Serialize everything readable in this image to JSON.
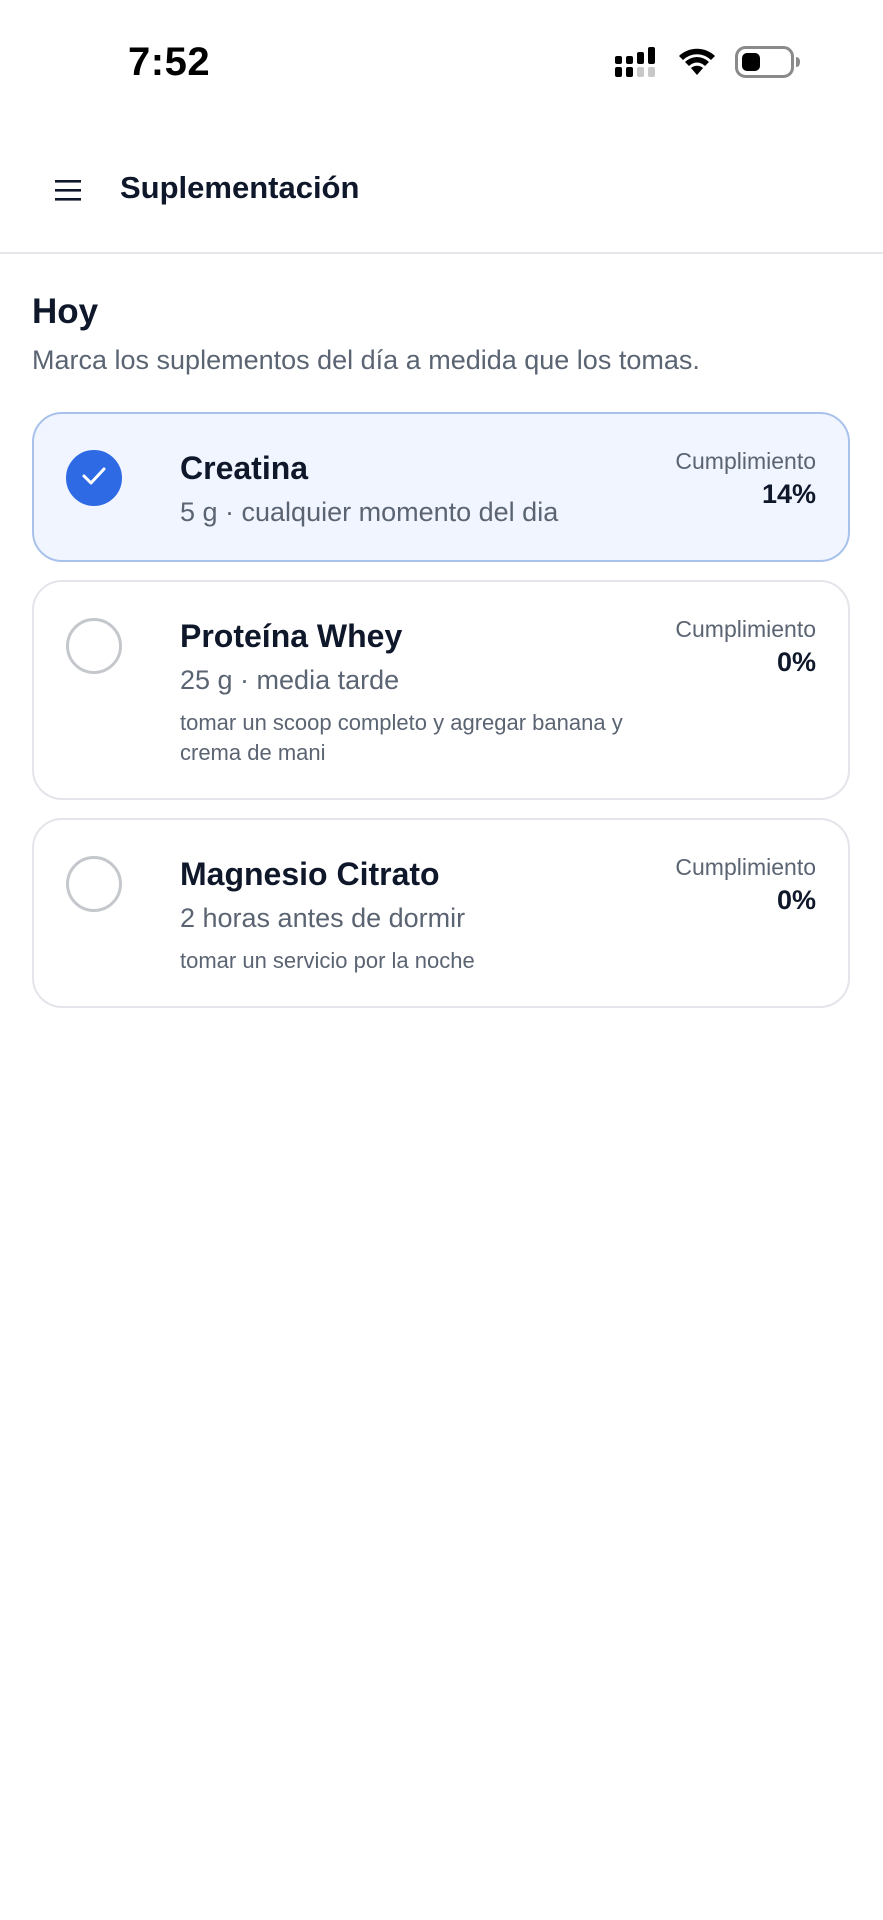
{
  "status_bar": {
    "time": "7:52",
    "icons": [
      "cellular-signal-icon",
      "wifi-icon",
      "battery-icon"
    ]
  },
  "app_bar": {
    "menu_icon": "hamburger-menu-icon",
    "title": "Suplementación"
  },
  "section": {
    "title": "Hoy",
    "subtitle": "Marca los suplementos del día a medida que los tomas."
  },
  "colors": {
    "accent": "#2f6ae5",
    "checked_card_bg": "#f0f5ff",
    "checked_card_border": "#a9c2ec"
  },
  "supplements": [
    {
      "name": "Creatina",
      "dose": "5 g · cualquier momento del dia",
      "note": "",
      "checked": true,
      "compliance_label": "Cumplimiento",
      "compliance_value": "14%"
    },
    {
      "name": "Proteína Whey",
      "dose": "25 g · media tarde",
      "note": "tomar un scoop completo y agregar banana y crema de mani",
      "checked": false,
      "compliance_label": "Cumplimiento",
      "compliance_value": "0%"
    },
    {
      "name": "Magnesio Citrato",
      "dose": "2 horas antes de dormir",
      "note": "tomar un servicio por la noche",
      "checked": false,
      "compliance_label": "Cumplimiento",
      "compliance_value": "0%"
    }
  ]
}
